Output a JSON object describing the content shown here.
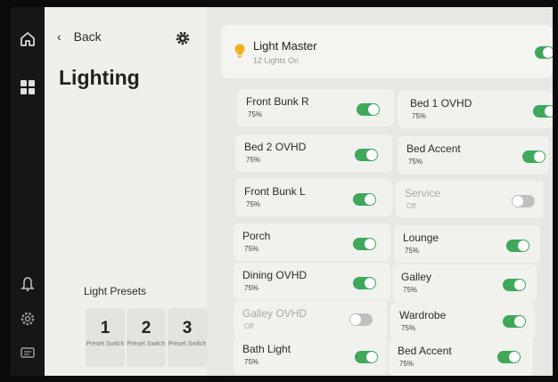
{
  "sidebar": {
    "back_label": "Back",
    "title": "Lighting",
    "presets_label": "Light Presets",
    "presets": [
      {
        "number": "1",
        "label": "Preset Switch"
      },
      {
        "number": "2",
        "label": "Preset Switch"
      },
      {
        "number": "3",
        "label": "Preset Switch"
      }
    ]
  },
  "master": {
    "name": "Light Master",
    "subtitle": "12 Lights On",
    "on": true
  },
  "lights": [
    {
      "name": "Front Bunk R",
      "value": "75%",
      "on": true
    },
    {
      "name": "Bed 1 OVHD",
      "value": "75%",
      "on": true
    },
    {
      "name": "Bed 2 OVHD",
      "value": "75%",
      "on": true
    },
    {
      "name": "Bed Accent",
      "value": "75%",
      "on": true
    },
    {
      "name": "Front Bunk L",
      "value": "75%",
      "on": true
    },
    {
      "name": "Service",
      "value": "Off",
      "on": false
    },
    {
      "name": "Porch",
      "value": "75%",
      "on": true
    },
    {
      "name": "Lounge",
      "value": "75%",
      "on": true
    },
    {
      "name": "Dining OVHD",
      "value": "75%",
      "on": true
    },
    {
      "name": "Galley",
      "value": "75%",
      "on": true
    },
    {
      "name": "Galley OVHD",
      "value": "Off",
      "on": false
    },
    {
      "name": "Wardrobe",
      "value": "75%",
      "on": true
    },
    {
      "name": "Bath Light",
      "value": "75%",
      "on": true
    },
    {
      "name": "Bed Accent",
      "value": "75%",
      "on": true
    }
  ],
  "colors": {
    "toggle_on": "#3fa85a",
    "toggle_off": "#bfc1bd",
    "bulb": "#f2b21c"
  },
  "icons": [
    "home-icon",
    "grid-icon",
    "bell-icon",
    "settings-gear-icon",
    "message-icon",
    "gear-icon",
    "chevron-left-icon",
    "bulb-icon"
  ]
}
